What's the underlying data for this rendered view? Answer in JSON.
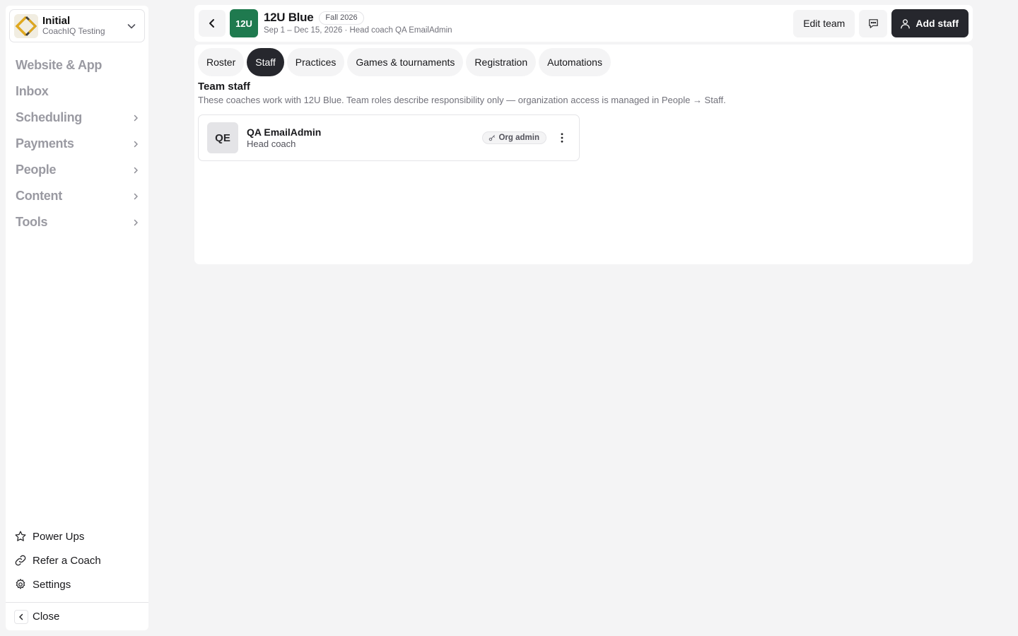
{
  "org": {
    "name": "Initial",
    "subtitle": "CoachIQ Testing"
  },
  "nav": {
    "items": [
      {
        "label": "Website & App",
        "has_children": false
      },
      {
        "label": "Inbox",
        "has_children": false
      },
      {
        "label": "Scheduling",
        "has_children": true
      },
      {
        "label": "Payments",
        "has_children": true
      },
      {
        "label": "People",
        "has_children": true
      },
      {
        "label": "Content",
        "has_children": true
      },
      {
        "label": "Tools",
        "has_children": true
      }
    ]
  },
  "bottom": {
    "power_ups": "Power Ups",
    "refer": "Refer a Coach",
    "settings": "Settings",
    "close": "Close"
  },
  "header": {
    "avatar_text": "12U",
    "team_name": "12U Blue",
    "season": "Fall 2026",
    "meta": "Sep 1 – Dec 15, 2026 · Head coach QA EmailAdmin",
    "edit_label": "Edit team",
    "add_staff_label": "Add staff",
    "accent_color": "#1f7a4f"
  },
  "tabs": [
    {
      "label": "Roster",
      "active": false
    },
    {
      "label": "Staff",
      "active": true
    },
    {
      "label": "Practices",
      "active": false
    },
    {
      "label": "Games & tournaments",
      "active": false
    },
    {
      "label": "Registration",
      "active": false
    },
    {
      "label": "Automations",
      "active": false
    }
  ],
  "staff_section": {
    "title": "Team staff",
    "description": "These coaches work with 12U Blue. Team roles describe responsibility only — organization access is managed in People → Staff.",
    "members": [
      {
        "initials": "QE",
        "name": "QA EmailAdmin",
        "role": "Head coach",
        "badge": "Org admin"
      }
    ]
  }
}
